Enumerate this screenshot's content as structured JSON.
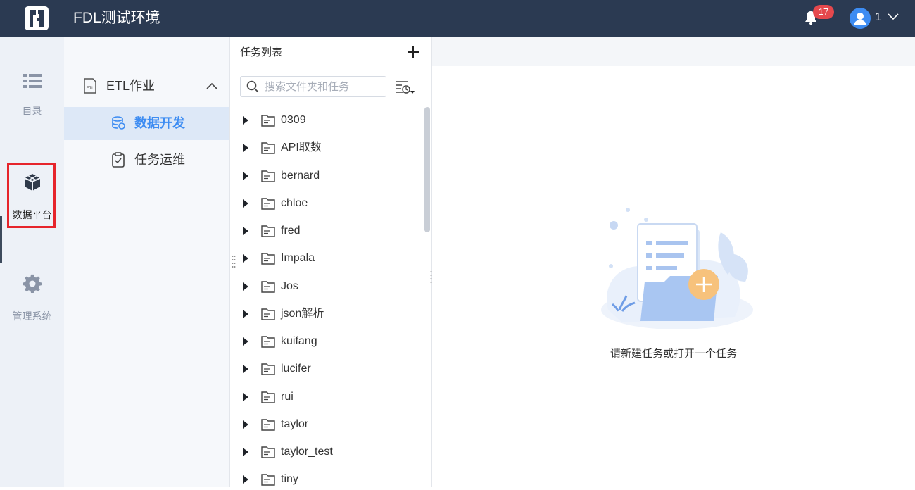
{
  "header": {
    "app_title": "FDL测试环境",
    "logo_icon": "fdl-logo-icon",
    "notification_count": "17",
    "user_name": "1"
  },
  "rail": {
    "items": [
      {
        "label": "目录",
        "icon": "list-icon"
      },
      {
        "label": "数据平台",
        "icon": "cube-icon",
        "active": true
      },
      {
        "label": "管理系统",
        "icon": "gear-icon"
      }
    ]
  },
  "subnav": {
    "group_label": "ETL作业",
    "items": [
      {
        "label": "数据开发",
        "icon": "database-icon",
        "active": true
      },
      {
        "label": "任务运维",
        "icon": "clipboard-check-icon"
      }
    ]
  },
  "tasks": {
    "title": "任务列表",
    "search_placeholder": "搜索文件夹和任务",
    "folders": [
      "0309",
      "API取数",
      "bernard",
      "chloe",
      "fred",
      "Impala",
      "Jos",
      "json解析",
      "kuifang",
      "lucifer",
      "rui",
      "taylor",
      "taylor_test",
      "tiny"
    ]
  },
  "main": {
    "empty_text": "请新建任务或打开一个任务"
  },
  "colors": {
    "topbar": "#2b3a52",
    "accent": "#3d8cf2",
    "badge": "#e5484d",
    "highlight": "#e6242b"
  }
}
